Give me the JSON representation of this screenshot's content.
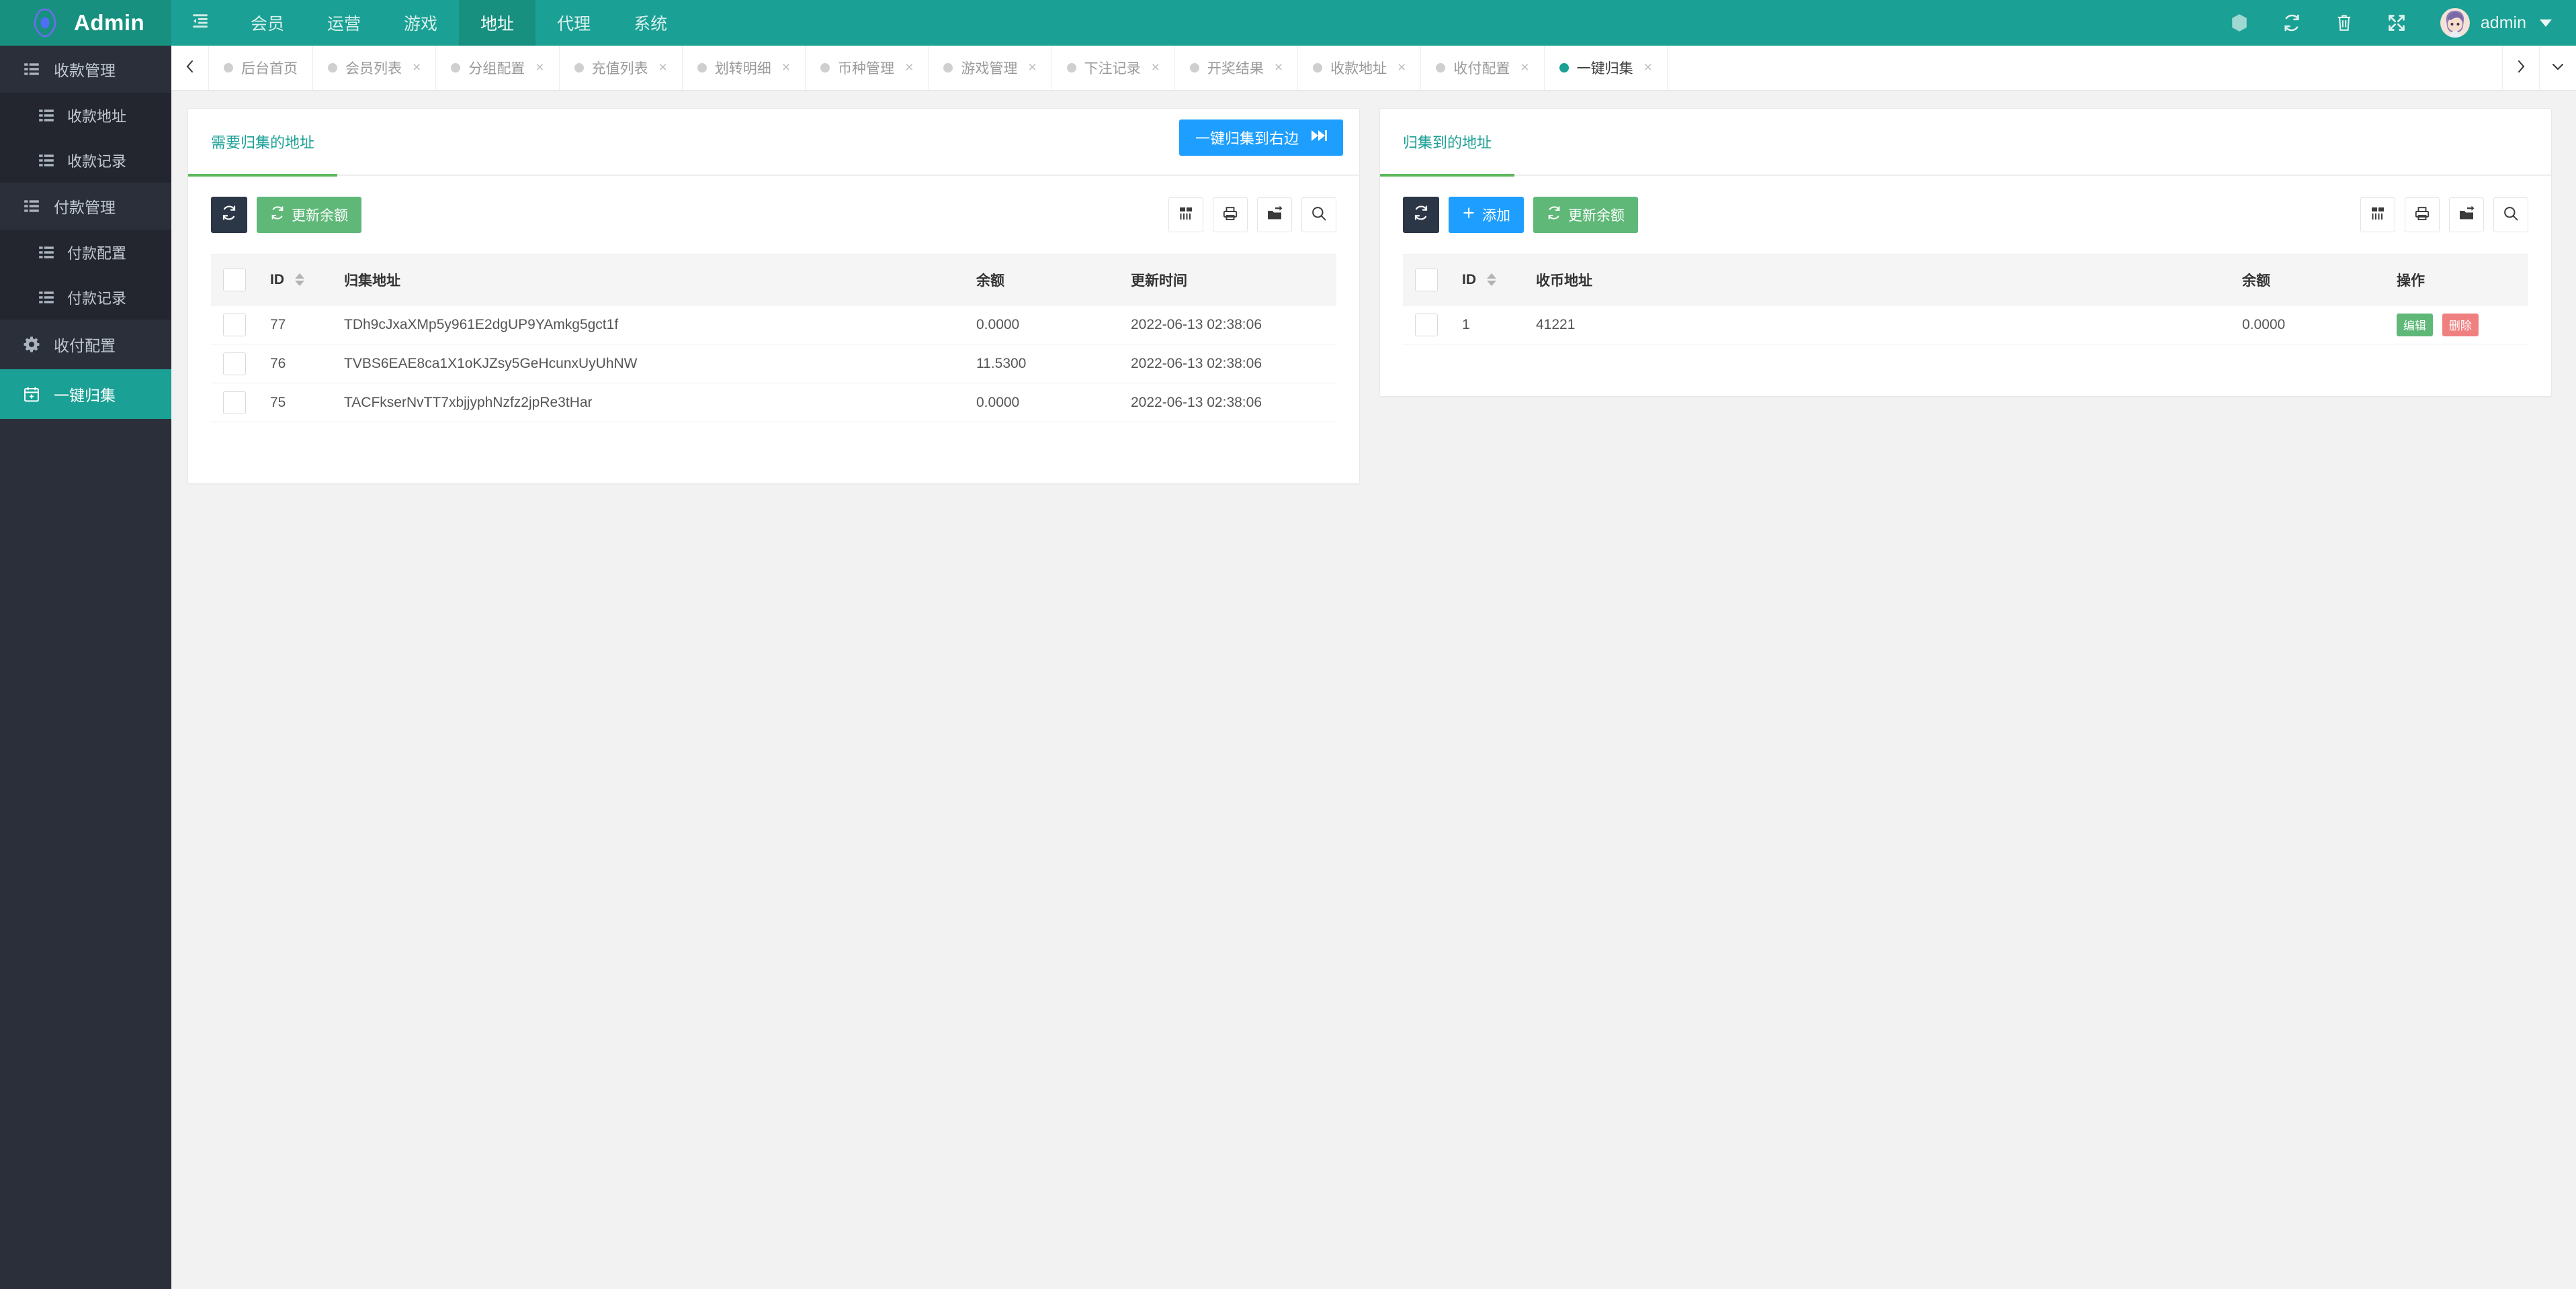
{
  "header": {
    "brand": "Admin",
    "logo_icon": "hexagon-eye-logo",
    "menu_toggle_icon": "indent-left-icon",
    "nav": [
      {
        "label": "会员",
        "active": false
      },
      {
        "label": "运营",
        "active": false
      },
      {
        "label": "游戏",
        "active": false
      },
      {
        "label": "地址",
        "active": true
      },
      {
        "label": "代理",
        "active": false
      },
      {
        "label": "系统",
        "active": false
      }
    ],
    "tools": [
      {
        "icon": "theme-hexagon-icon",
        "name": "theme-button"
      },
      {
        "icon": "refresh-icon",
        "name": "refresh-button"
      },
      {
        "icon": "trash-icon",
        "name": "clear-cache-button"
      },
      {
        "icon": "fullscreen-icon",
        "name": "fullscreen-button"
      }
    ],
    "user": "admin",
    "avatar_icon": "user-avatar"
  },
  "sidebar": {
    "groups": [
      {
        "title": "收款管理",
        "icon": "list-icon",
        "items": [
          {
            "label": "收款地址",
            "icon": "list-icon"
          },
          {
            "label": "收款记录",
            "icon": "list-icon"
          }
        ]
      },
      {
        "title": "付款管理",
        "icon": "list-icon",
        "items": [
          {
            "label": "付款配置",
            "icon": "list-icon"
          },
          {
            "label": "付款记录",
            "icon": "list-icon"
          }
        ]
      }
    ],
    "roots": [
      {
        "label": "收付配置",
        "icon": "gear-icon",
        "active": false
      },
      {
        "label": "一键归集",
        "icon": "calendar-plus-icon",
        "active": true
      }
    ]
  },
  "tabbar": {
    "prev_icon": "chevron-left-icon",
    "next_icon": "chevron-right-icon",
    "dropdown_icon": "chevron-down-icon",
    "tabs": [
      {
        "label": "后台首页",
        "active": false,
        "closable": false
      },
      {
        "label": "会员列表",
        "active": false,
        "closable": true
      },
      {
        "label": "分组配置",
        "active": false,
        "closable": true
      },
      {
        "label": "充值列表",
        "active": false,
        "closable": true
      },
      {
        "label": "划转明细",
        "active": false,
        "closable": true
      },
      {
        "label": "币种管理",
        "active": false,
        "closable": true
      },
      {
        "label": "游戏管理",
        "active": false,
        "closable": true
      },
      {
        "label": "下注记录",
        "active": false,
        "closable": true
      },
      {
        "label": "开奖结果",
        "active": false,
        "closable": true
      },
      {
        "label": "收款地址",
        "active": false,
        "closable": true
      },
      {
        "label": "收付配置",
        "active": false,
        "closable": true
      },
      {
        "label": "一键归集",
        "active": true,
        "closable": true
      }
    ],
    "close_glyph": "×"
  },
  "left_panel": {
    "tab_label": "需要归集的地址",
    "action_button": {
      "label": "一键归集到右边",
      "icon": "fast-forward-icon"
    },
    "toolbar": {
      "refresh_icon": "refresh-icon",
      "update_balance_label": "更新余额",
      "update_balance_icon": "refresh-icon",
      "right_icons": [
        {
          "icon": "column-filter-icon",
          "name": "column-filter-button"
        },
        {
          "icon": "printer-icon",
          "name": "print-button"
        },
        {
          "icon": "export-icon",
          "name": "export-button"
        },
        {
          "icon": "search-icon",
          "name": "search-button"
        }
      ]
    },
    "table": {
      "columns": [
        "",
        "ID",
        "归集地址",
        "余额",
        "更新时间"
      ],
      "rows": [
        {
          "id": "77",
          "address": "TDh9cJxaXMp5y961E2dgUP9YAmkg5gct1f",
          "balance": "0.0000",
          "updated": "2022-06-13 02:38:06"
        },
        {
          "id": "76",
          "address": "TVBS6EAE8ca1X1oKJZsy5GeHcunxUyUhNW",
          "balance": "11.5300",
          "updated": "2022-06-13 02:38:06"
        },
        {
          "id": "75",
          "address": "TACFkserNvTT7xbjjyphNzfz2jpRe3tHar",
          "balance": "0.0000",
          "updated": "2022-06-13 02:38:06"
        }
      ]
    }
  },
  "right_panel": {
    "tab_label": "归集到的地址",
    "toolbar": {
      "refresh_icon": "refresh-icon",
      "add_label": "添加",
      "add_icon": "plus-icon",
      "update_balance_label": "更新余额",
      "update_balance_icon": "refresh-icon",
      "right_icons": [
        {
          "icon": "column-filter-icon",
          "name": "column-filter-button"
        },
        {
          "icon": "printer-icon",
          "name": "print-button"
        },
        {
          "icon": "export-icon",
          "name": "export-button"
        },
        {
          "icon": "search-icon",
          "name": "search-button"
        }
      ]
    },
    "table": {
      "columns": [
        "",
        "ID",
        "收币地址",
        "余额",
        "操作"
      ],
      "rows": [
        {
          "id": "1",
          "address": "41221",
          "balance": "0.0000",
          "edit_label": "编辑",
          "delete_label": "删除"
        }
      ]
    }
  },
  "colors": {
    "brand_teal": "#1aa094",
    "brand_teal_dark": "#17907f",
    "sidebar_bg": "#2b2f3a",
    "sidebar_sub_bg": "#23262f",
    "accent_blue": "#1e9fff",
    "accent_green": "#5fb878",
    "danger_red": "#f08080",
    "tab_underline": "#5cb85c"
  }
}
